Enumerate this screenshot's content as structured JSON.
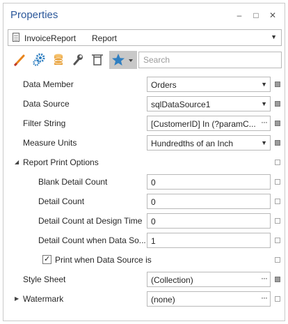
{
  "window": {
    "title": "Properties",
    "controls": {
      "minimize": "–",
      "maximize": "□",
      "close": "✕"
    }
  },
  "object_selector": {
    "name": "InvoiceReport",
    "type": "Report"
  },
  "toolbar": {
    "buttons": [
      "appearance-icon",
      "behavior-icon",
      "data-icon",
      "design-icon",
      "layout-icon",
      "favorites-icon"
    ],
    "active_button": "favorites-icon",
    "search_placeholder": "Search"
  },
  "properties": {
    "data_member": {
      "label": "Data Member",
      "value": "Orders"
    },
    "data_source": {
      "label": "Data Source",
      "value": "sqlDataSource1"
    },
    "filter_string": {
      "label": "Filter String",
      "value": "[CustomerID]  In  (?paramC..."
    },
    "measure_units": {
      "label": "Measure Units",
      "value": "Hundredths of an Inch"
    },
    "report_print_options": {
      "label": "Report Print Options",
      "blank_detail_count": {
        "label": "Blank Detail Count",
        "value": "0"
      },
      "detail_count": {
        "label": "Detail Count",
        "value": "0"
      },
      "detail_count_design": {
        "label": "Detail Count at Design Time",
        "value": "0"
      },
      "detail_count_empty": {
        "label": "Detail Count when Data So...",
        "value": "1"
      },
      "print_when_empty": {
        "label": "Print when Data Source is",
        "checked": true
      }
    },
    "style_sheet": {
      "label": "Style Sheet",
      "value": "(Collection)"
    },
    "watermark": {
      "label": "Watermark",
      "value": "(none)"
    }
  },
  "colors": {
    "title": "#2b579a",
    "active_tool": "#c8c8c8",
    "border": "#b9b9b9"
  }
}
